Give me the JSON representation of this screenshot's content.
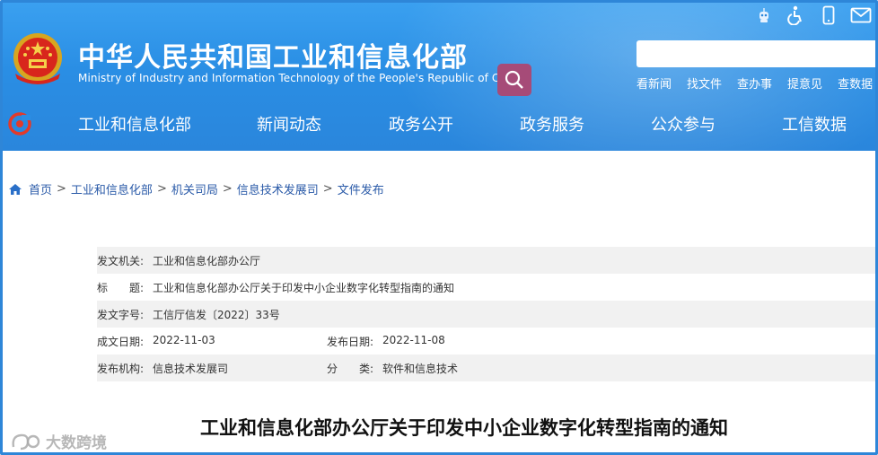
{
  "header": {
    "title": "中华人民共和国工业和信息化部",
    "subtitle": "Ministry of Industry and Information Technology of the People's Republic of China",
    "search": {
      "placeholder": ""
    },
    "top_icons": [
      "robot-icon",
      "accessibility-icon",
      "mobile-icon",
      "mail-icon"
    ],
    "quick_links": [
      "看新闻",
      "找文件",
      "查办事",
      "提意见",
      "查数据"
    ]
  },
  "nav": {
    "items": [
      "工业和信息化部",
      "新闻动态",
      "政务公开",
      "政务服务",
      "公众参与",
      "工信数据"
    ]
  },
  "breadcrumb": {
    "items": [
      "首页",
      "工业和信息化部",
      "机关司局",
      "信息技术发展司",
      "文件发布"
    ],
    "separator": ">"
  },
  "meta": {
    "issuer_label": "发文机关:",
    "issuer": "工业和信息化部办公厅",
    "title_label": "标　　题:",
    "title": "工业和信息化部办公厅关于印发中小企业数字化转型指南的通知",
    "docno_label": "发文字号:",
    "docno": "工信厅信发〔2022〕33号",
    "created_label": "成文日期:",
    "created": "2022-11-03",
    "published_label": "发布日期:",
    "published": "2022-11-08",
    "org_label": "发布机构:",
    "org": "信息技术发展司",
    "category_label": "分　　类:",
    "category": "软件和信息技术"
  },
  "document": {
    "heading": "工业和信息化部办公厅关于印发中小企业数字化转型指南的通知"
  },
  "watermark": {
    "text": "大数跨境"
  },
  "colors": {
    "header_blue": "#2a8ee4",
    "search_button": "#a64b78",
    "link_blue": "#2a5aa8",
    "frame_border": "#2e86d8"
  }
}
